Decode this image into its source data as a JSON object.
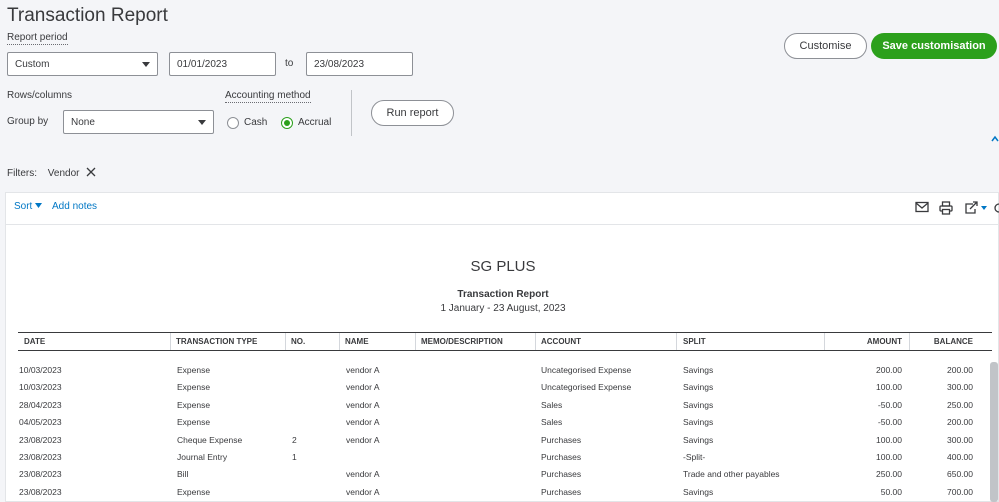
{
  "header": {
    "title": "Transaction Report"
  },
  "report_period": {
    "label": "Report period",
    "value": "Custom",
    "from": "01/01/2023",
    "to_label": "to",
    "to": "23/08/2023"
  },
  "rows_columns": {
    "label": "Rows/columns",
    "group_by_label": "Group by",
    "group_by_value": "None"
  },
  "accounting_method": {
    "label": "Accounting method",
    "options": [
      "Cash",
      "Accrual"
    ],
    "selected": "Accrual"
  },
  "buttons": {
    "run_report": "Run report",
    "customise": "Customise",
    "save_customisation": "Save customisation"
  },
  "filters": {
    "label": "Filters:",
    "chip": "Vendor"
  },
  "toolbar": {
    "sort": "Sort",
    "add_notes": "Add notes"
  },
  "report": {
    "company": "SG PLUS",
    "title": "Transaction Report",
    "dates": "1 January - 23 August, 2023",
    "columns": [
      "DATE",
      "TRANSACTION TYPE",
      "NO.",
      "NAME",
      "MEMO/DESCRIPTION",
      "ACCOUNT",
      "SPLIT",
      "AMOUNT",
      "BALANCE"
    ],
    "rows": [
      [
        "10/03/2023",
        "Expense",
        "",
        "vendor A",
        "",
        "Uncategorised Expense",
        "Savings",
        "200.00",
        "200.00"
      ],
      [
        "10/03/2023",
        "Expense",
        "",
        "vendor A",
        "",
        "Uncategorised Expense",
        "Savings",
        "100.00",
        "300.00"
      ],
      [
        "28/04/2023",
        "Expense",
        "",
        "vendor A",
        "",
        "Sales",
        "Savings",
        "-50.00",
        "250.00"
      ],
      [
        "04/05/2023",
        "Expense",
        "",
        "vendor A",
        "",
        "Sales",
        "Savings",
        "-50.00",
        "200.00"
      ],
      [
        "23/08/2023",
        "Cheque Expense",
        "2",
        "vendor A",
        "",
        "Purchases",
        "Savings",
        "100.00",
        "300.00"
      ],
      [
        "23/08/2023",
        "Journal Entry",
        "1",
        "",
        "",
        "Purchases",
        "-Split-",
        "100.00",
        "400.00"
      ],
      [
        "23/08/2023",
        "Bill",
        "",
        "vendor A",
        "",
        "Purchases",
        "Trade and other payables",
        "250.00",
        "650.00"
      ],
      [
        "23/08/2023",
        "Expense",
        "",
        "vendor A",
        "",
        "Purchases",
        "Savings",
        "50.00",
        "700.00"
      ]
    ]
  },
  "colors": {
    "accent": "#2ca01c",
    "link": "#0077c5",
    "background": "#f4f5f8"
  }
}
